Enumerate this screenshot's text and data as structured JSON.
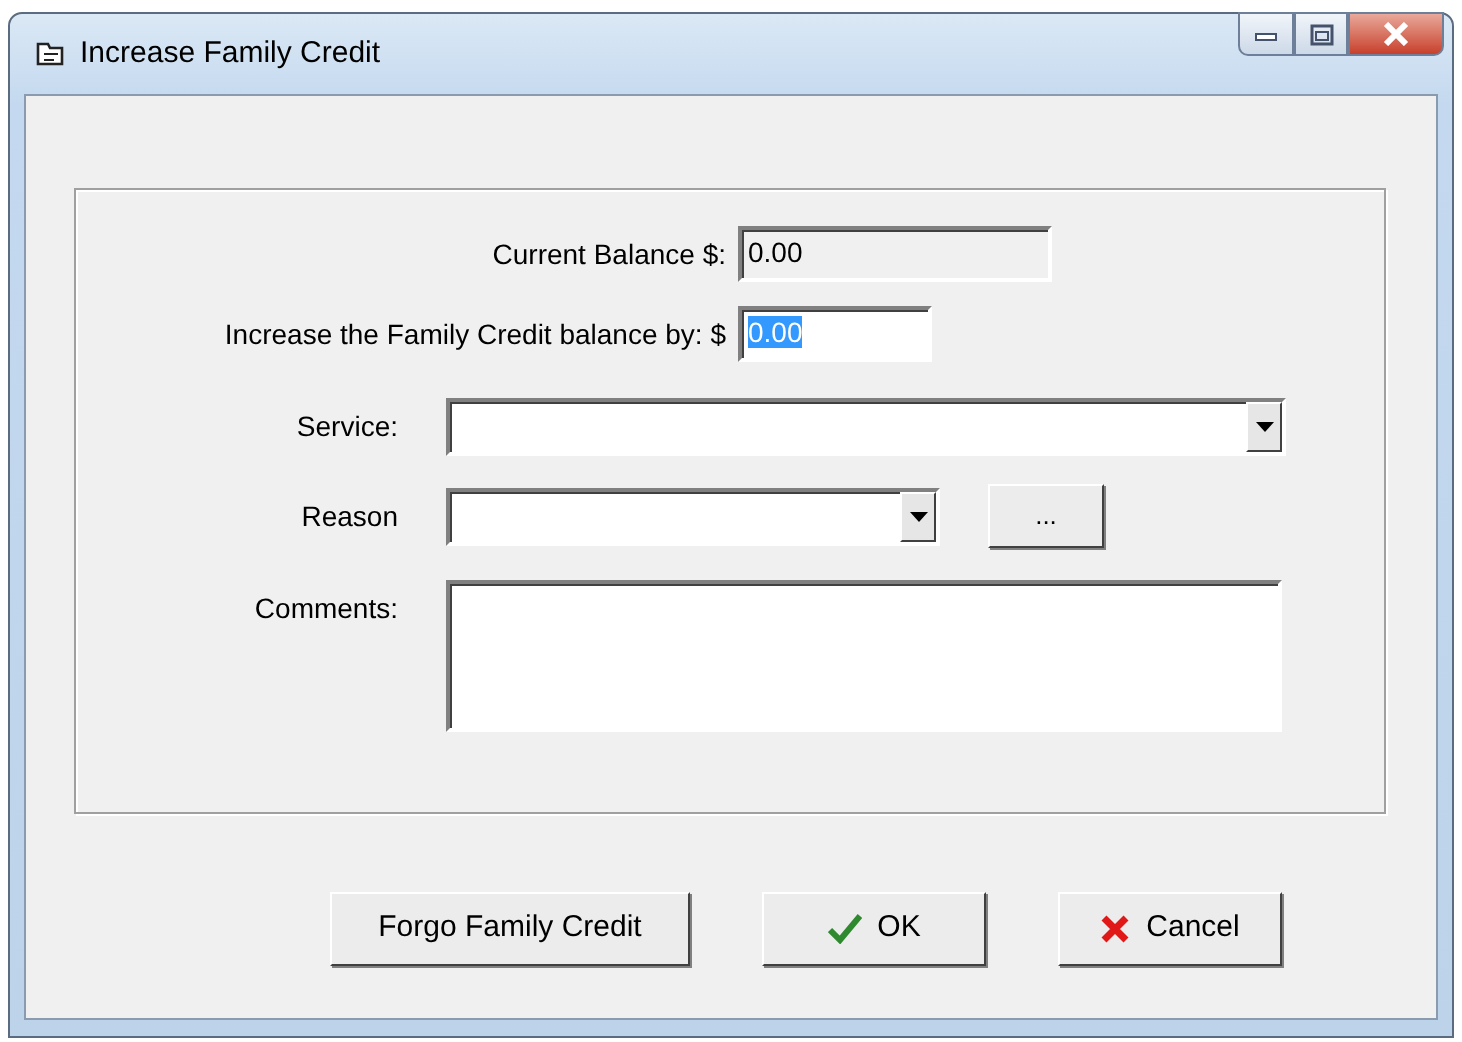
{
  "window": {
    "title": "Increase Family Credit"
  },
  "fields": [
    {
      "kind": "text",
      "label": "Current Balance $:",
      "value": "0.00",
      "disabled": true,
      "selected": false
    },
    {
      "kind": "text",
      "label": "Increase the Family Credit balance by:  $",
      "value": "0.00",
      "disabled": false,
      "selected": true
    },
    {
      "kind": "combo",
      "label": "Service:"
    },
    {
      "kind": "combo-browse",
      "label": "Reason",
      "browse": "..."
    },
    {
      "kind": "memo",
      "label": "Comments:"
    }
  ],
  "buttons": [
    {
      "label": "Forgo Family Credit",
      "kind": "plain"
    },
    {
      "label": "OK",
      "kind": "ok"
    },
    {
      "label": "Cancel",
      "kind": "cancel"
    }
  ]
}
